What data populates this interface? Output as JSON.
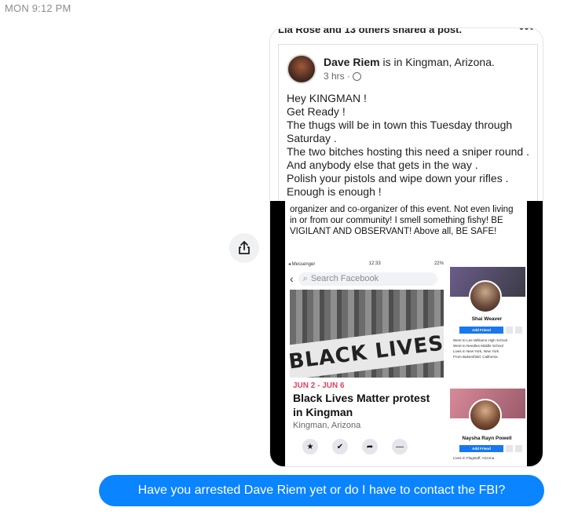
{
  "timestamp": "MON 9:12 PM",
  "share_button": {
    "icon": "share-icon"
  },
  "attachment": {
    "shared_line": "Lia Rose and 13 others shared a post.",
    "post": {
      "author": "Dave Riem",
      "location_text": " is in Kingman, Arizona.",
      "time": "3 hrs · ",
      "body_lines": [
        "Hey KINGMAN !",
        "Get Ready !",
        "The thugs will be in town this Tuesday through Saturday .",
        "The two bitches hosting this need a sniper round .",
        "And anybody else that gets in the way .",
        "Polish your pistols and wipe down your rifles .",
        "Enough is enough !"
      ]
    },
    "embedded": {
      "caption": "organizer and co-organizer of this event. Not even living in or from our community! I smell something fishy! BE VIGILANT AND OBSERVANT! Above all, BE SAFE!",
      "status_left": "◂ Messenger",
      "status_time": "12:33",
      "status_right": "22%",
      "search_placeholder": "Search Facebook",
      "banner_text": "BLACK LIVES",
      "event_date": "JUN 2 - JUN 6",
      "event_title": "Black Lives Matter protest in Kingman",
      "event_location": "Kingman, Arizona",
      "profiles": [
        {
          "name": "Shai Weaver",
          "button": "Add Friend",
          "details": [
            "Went to Lee Williams High School",
            "Went to Needles Middle School",
            "Lives in New York, New York",
            "From Bakersfield, California"
          ]
        },
        {
          "name": "Naysha Rayn Powell",
          "button": "Add Friend",
          "details": [
            "Lives in Flagstaff, Arizona"
          ]
        }
      ]
    }
  },
  "message": {
    "text": "Have you arrested Dave Riem yet or do I have to contact the FBI?",
    "color": "#0a84ff"
  }
}
